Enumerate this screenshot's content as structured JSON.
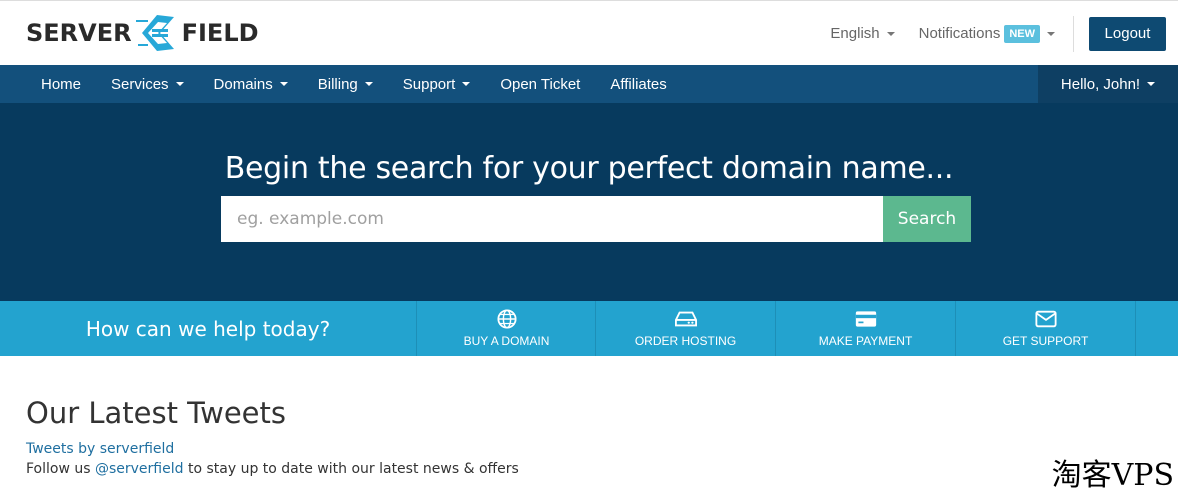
{
  "brand": {
    "left": "SERVER",
    "right": "FIELD",
    "logo_icon": "server-field-logo-mark"
  },
  "header": {
    "language": "English",
    "notifications_label": "Notifications",
    "notifications_badge": "NEW",
    "logout_label": "Logout"
  },
  "nav": {
    "items": [
      {
        "label": "Home",
        "dropdown": false
      },
      {
        "label": "Services",
        "dropdown": true
      },
      {
        "label": "Domains",
        "dropdown": true
      },
      {
        "label": "Billing",
        "dropdown": true
      },
      {
        "label": "Support",
        "dropdown": true
      },
      {
        "label": "Open Ticket",
        "dropdown": false
      },
      {
        "label": "Affiliates",
        "dropdown": false
      }
    ],
    "user_greeting": "Hello, John!"
  },
  "hero": {
    "title": "Begin the search for your perfect domain name...",
    "search_placeholder": "eg. example.com",
    "search_button": "Search"
  },
  "help": {
    "title": "How can we help today?",
    "actions": [
      {
        "label": "BUY A DOMAIN",
        "icon": "globe-icon"
      },
      {
        "label": "ORDER HOSTING",
        "icon": "hard-drive-icon"
      },
      {
        "label": "MAKE PAYMENT",
        "icon": "credit-card-icon"
      },
      {
        "label": "GET SUPPORT",
        "icon": "envelope-icon"
      }
    ]
  },
  "tweets": {
    "title": "Our Latest Tweets",
    "link": "Tweets by serverfield",
    "follow_prefix": "Follow us ",
    "follow_handle": "@serverfield",
    "follow_suffix": " to stay up to date with our latest news & offers"
  },
  "watermark": "淘客VPS",
  "colors": {
    "nav": "#13507c",
    "hero": "#073a5e",
    "help": "#23a3cf",
    "search_button": "#5cb88f",
    "logout": "#0e4a72",
    "badge": "#5bc0de"
  }
}
